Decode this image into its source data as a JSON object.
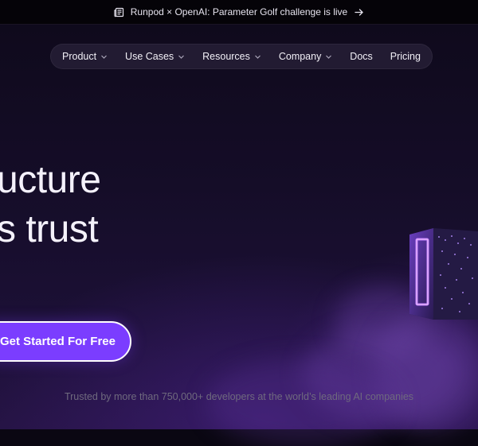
{
  "announcement": {
    "text": "Runpod × OpenAI: Parameter Golf challenge is live",
    "icon": "newspaper-icon",
    "arrow_icon": "arrow-right-icon"
  },
  "nav": {
    "items": [
      {
        "label": "Product",
        "has_dropdown": true
      },
      {
        "label": "Use Cases",
        "has_dropdown": true
      },
      {
        "label": "Resources",
        "has_dropdown": true
      },
      {
        "label": "Company",
        "has_dropdown": true
      },
      {
        "label": "Docs",
        "has_dropdown": false
      },
      {
        "label": "Pricing",
        "has_dropdown": false
      }
    ]
  },
  "hero": {
    "headline_line1": "ucture",
    "headline_line2": "s trust",
    "cta_label": "Get Started For Free",
    "trusted_text": "Trusted by more than 750,000+ developers at the world’s leading AI companies"
  },
  "colors": {
    "accent": "#7b3dff",
    "background": "#0a0712"
  }
}
